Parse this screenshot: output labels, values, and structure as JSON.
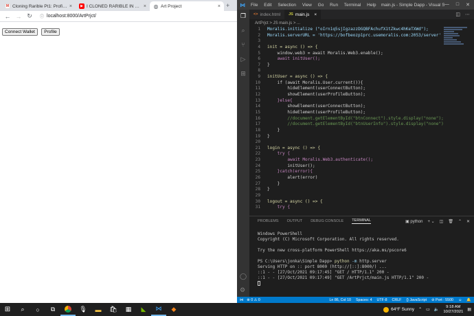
{
  "browser": {
    "tabs": [
      {
        "title": "Cloning Rarible Pt1: Profile Btn ...",
        "icon": "gmail-icon",
        "color": "#ffffff"
      },
      {
        "title": "I CLONED RARIBLE IN 24 HOURS...",
        "icon": "youtube-icon",
        "color": "#ff0000"
      },
      {
        "title": "Art Project",
        "icon": "globe-icon",
        "color": "#5f6368"
      }
    ],
    "url": "localhost:8000/ArtPrjct/",
    "page": {
      "connect_label": "Connect Wallet",
      "profile_label": "Profile"
    }
  },
  "vscode": {
    "menu": [
      "File",
      "Edit",
      "Selection",
      "View",
      "Go",
      "Run",
      "Terminal",
      "Help"
    ],
    "window_title": "main.js - Simple Dapp - Visual Studio ...",
    "editor_tabs": [
      {
        "label": "index.html",
        "icon": "<>",
        "active": false
      },
      {
        "label": "main.js",
        "icon": "JS",
        "active": true
      }
    ],
    "breadcrumb": "ArtPrjct > JS main.js > ...",
    "code_lines": [
      {
        "n": "1",
        "t": "Moralis.initialize (\"oIrn1q5sjIgzazzDGQBFAchufX1tZkwc4hKeTXWd\");"
      },
      {
        "n": "2",
        "t": "Moralis.serverURL = 'https://bofbeozp1prc.usemoralis.com:2053/server'"
      },
      {
        "n": "3",
        "t": ""
      },
      {
        "n": "4",
        "t": "init = async () => {"
      },
      {
        "n": "5",
        "t": "    window.web3 = await Moralis.Web3.enable();"
      },
      {
        "n": "6",
        "t": "    await initUser();"
      },
      {
        "n": "7",
        "t": "}"
      },
      {
        "n": "8",
        "t": ""
      },
      {
        "n": "9",
        "t": "initUser = async () => {"
      },
      {
        "n": "10",
        "t": "    if (await Moralis.User.current()){"
      },
      {
        "n": "11",
        "t": "        hideElement(userConnectButton);"
      },
      {
        "n": "12",
        "t": "        showElement(userProfileButton);"
      },
      {
        "n": "13",
        "t": "    }else{"
      },
      {
        "n": "14",
        "t": "        showElement(userConnectButton);"
      },
      {
        "n": "15",
        "t": "        hideElement(userProfileButton);"
      },
      {
        "n": "16",
        "t": "        //document.getElementById(\"btnConnect\").style.display(\"none\");"
      },
      {
        "n": "17",
        "t": "        //document.getElementById(\"btnUserInfo\").style.display(\"none\")"
      },
      {
        "n": "18",
        "t": "    }"
      },
      {
        "n": "19",
        "t": "}"
      },
      {
        "n": "20",
        "t": ""
      },
      {
        "n": "21",
        "t": "login = async () => {"
      },
      {
        "n": "22",
        "t": "    try {"
      },
      {
        "n": "23",
        "t": "        await Moralis.Web3.authenticate();"
      },
      {
        "n": "24",
        "t": "        initUser();"
      },
      {
        "n": "25",
        "t": "    }catch(error){"
      },
      {
        "n": "26",
        "t": "        alert(error)"
      },
      {
        "n": "27",
        "t": "    }"
      },
      {
        "n": "28",
        "t": "}"
      },
      {
        "n": "29",
        "t": ""
      },
      {
        "n": "30",
        "t": "logout = async () => {"
      },
      {
        "n": "31",
        "t": "    try {"
      }
    ],
    "panel_tabs": [
      "PROBLEMS",
      "OUTPUT",
      "DEBUG CONSOLE",
      "TERMINAL"
    ],
    "terminal_selector": "python",
    "terminal": {
      "l1": "Windows PowerShell",
      "l2": "Copyright (C) Microsoft Corporation. All rights reserved.",
      "l3": "Try the new cross-platform PowerShell https://aka.ms/pscore6",
      "prompt": "PS C:\\Users\\jonka\\Simple Dapp> ",
      "cmd": "python",
      "flag": " -m",
      "arg": " http.server",
      "l5": "Serving HTTP on :: port 8000 (http://[::]:8000/) ...",
      "l6": "::1 - - [27/Oct/2021 09:17:45] \"GET / HTTP/1.1\" 200 -",
      "l7": "::1 - - [27/Oct/2021 09:17:49] \"GET /ArtPrjct/main.js HTTP/1.1\" 200 -"
    },
    "status": {
      "errors": "⊗ 0  ⚠ 0",
      "position": "Ln 86, Col 10",
      "spaces": "Spaces: 4",
      "encoding": "UTF-8",
      "eol": "CRLF",
      "language": "{} JavaScript",
      "port": "⊘ Port : 5500"
    }
  },
  "taskbar": {
    "weather": "64°F  Sunny",
    "time": "9:18 AM",
    "date": "10/27/2021"
  }
}
